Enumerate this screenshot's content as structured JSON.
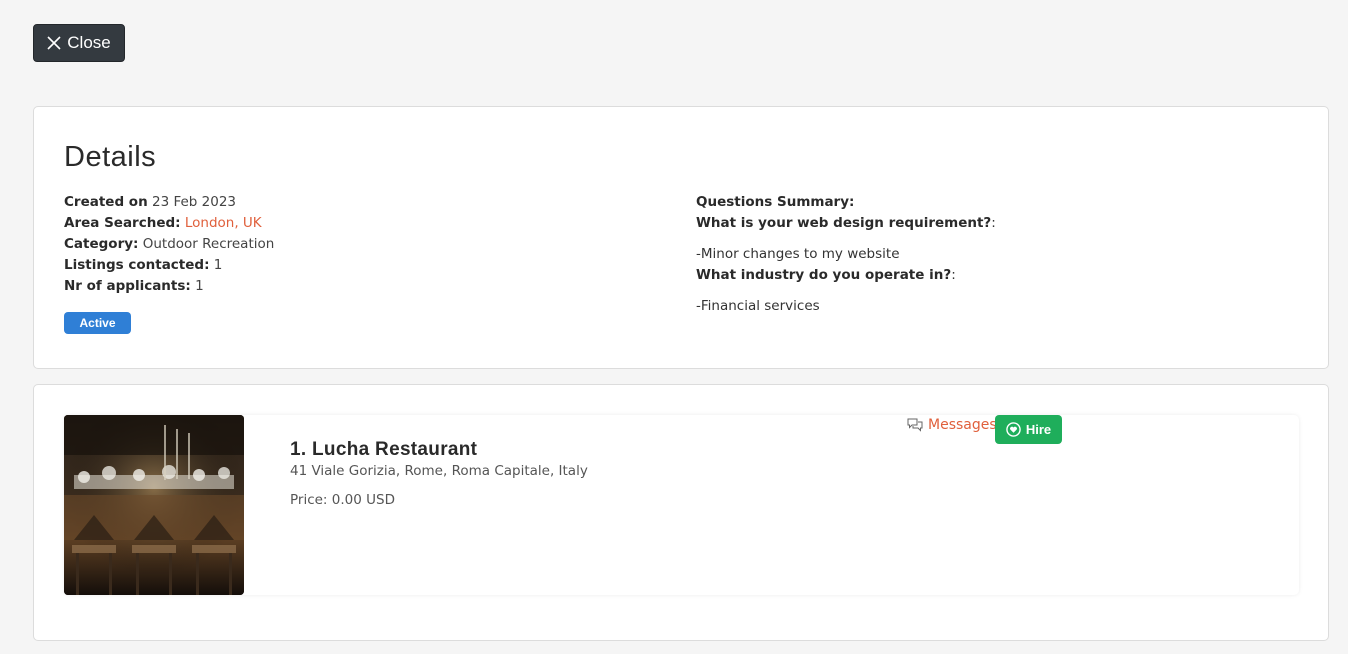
{
  "close_button": {
    "label": "Close"
  },
  "details": {
    "title": "Details",
    "created_label": "Created on",
    "created_value": "23 Feb 2023",
    "area_label": "Area Searched:",
    "area_value": "London, UK",
    "category_label": "Category:",
    "category_value": "Outdoor Recreation",
    "listings_label": "Listings contacted:",
    "listings_value": "1",
    "applicants_label": "Nr of applicants:",
    "applicants_value": "1",
    "status": "Active",
    "questions_title": "Questions Summary:",
    "q1": "What is your web design requirement?",
    "q1_suffix": ":",
    "a1": "-Minor changes to my website",
    "q2": "What industry do you operate in?",
    "q2_suffix": ":",
    "a2": "-Financial services"
  },
  "listing": {
    "name": "1. Lucha Restaurant",
    "address": "41 Viale Gorizia, Rome, Roma Capitale, Italy",
    "price": "Price: 0.00 USD",
    "messages_label": "Messages",
    "hire_label": "Hire"
  },
  "colors": {
    "accent_orange": "#e0603c",
    "status_blue": "#2f7fd6",
    "hire_green": "#1fae5b",
    "close_dark": "#343a40"
  }
}
